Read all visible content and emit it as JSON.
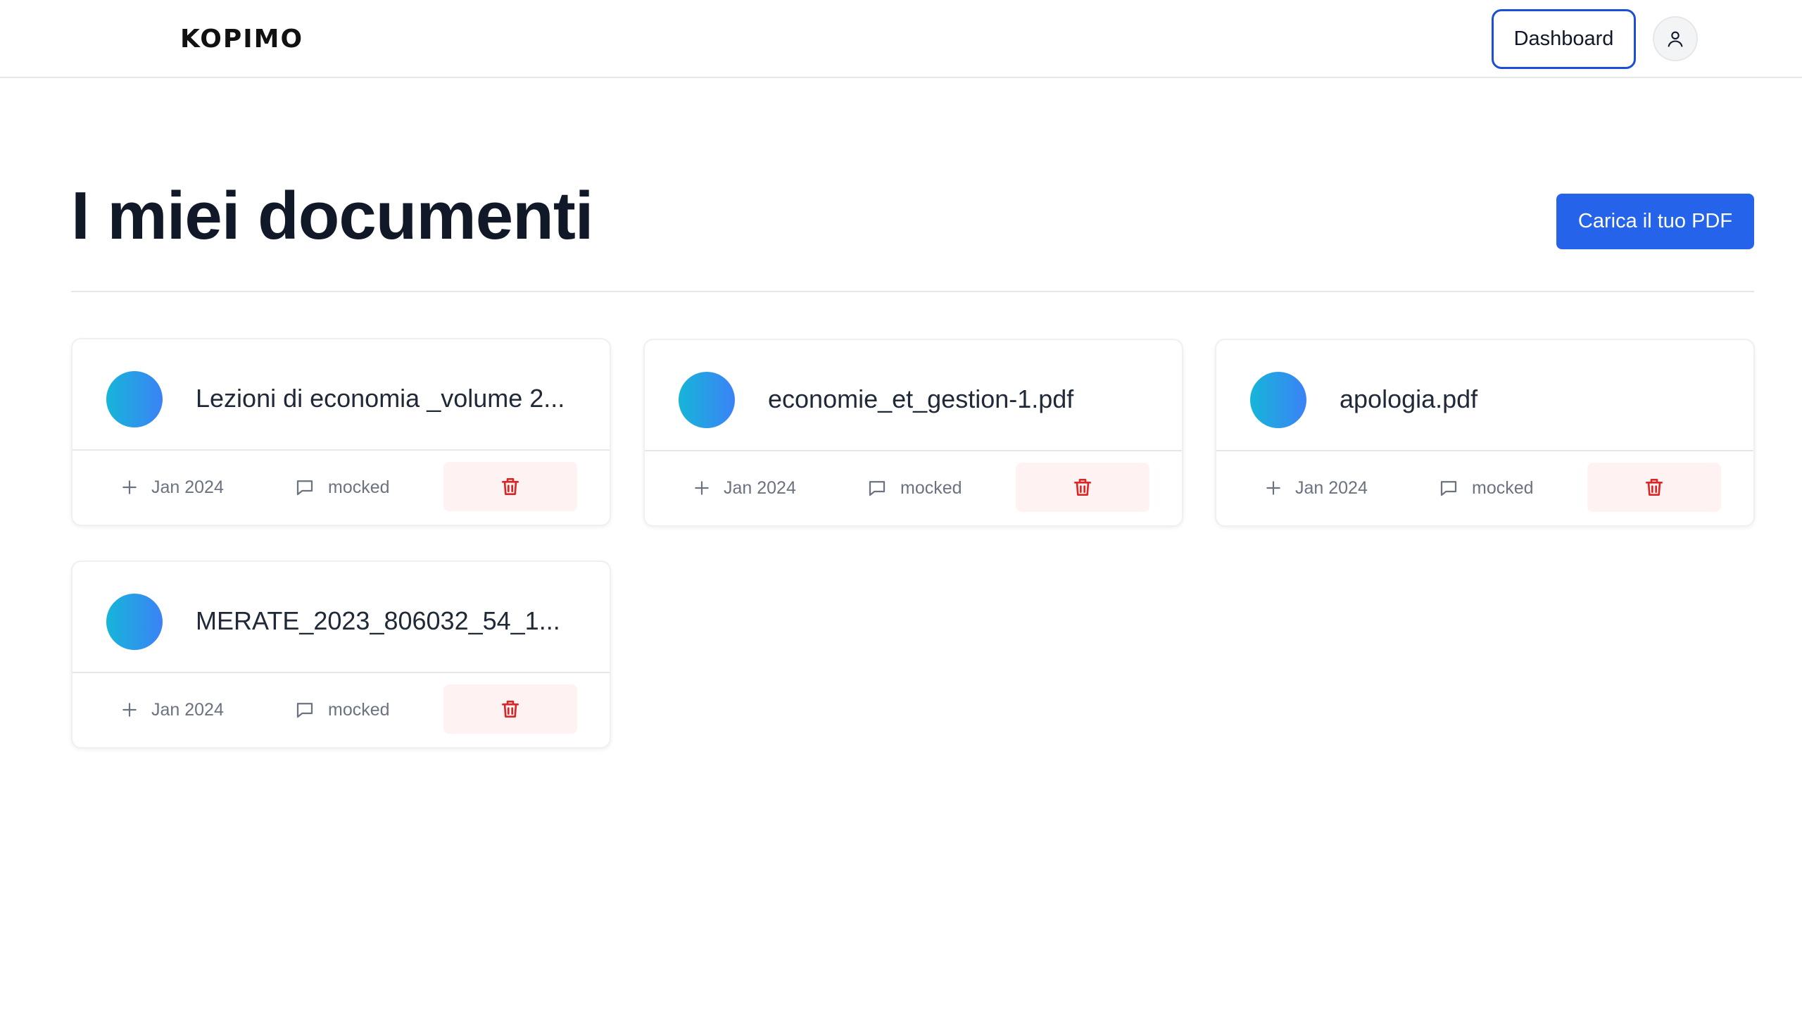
{
  "header": {
    "logo_text": "KOPIMO",
    "dashboard_label": "Dashboard",
    "account_icon": "user-icon"
  },
  "main": {
    "title": "I miei documenti",
    "upload_label": "Carica il tuo PDF"
  },
  "documents": [
    {
      "name": "Lezioni di economia _volume 2...",
      "date": "Jan 2024",
      "comment": "mocked"
    },
    {
      "name": "economie_et_gestion-1.pdf",
      "date": "Jan 2024",
      "comment": "mocked"
    },
    {
      "name": "apologia.pdf",
      "date": "Jan 2024",
      "comment": "mocked"
    },
    {
      "name": "MERATE_2023_806032_54_1...",
      "date": "Jan 2024",
      "comment": "mocked"
    }
  ],
  "colors": {
    "primary": "#2563eb",
    "outline": "#1d4ed8",
    "danger": "#dc2626",
    "danger_bg": "#fef2f2",
    "dot_gradient_start": "#16b5d9",
    "dot_gradient_end": "#3b82f6"
  }
}
